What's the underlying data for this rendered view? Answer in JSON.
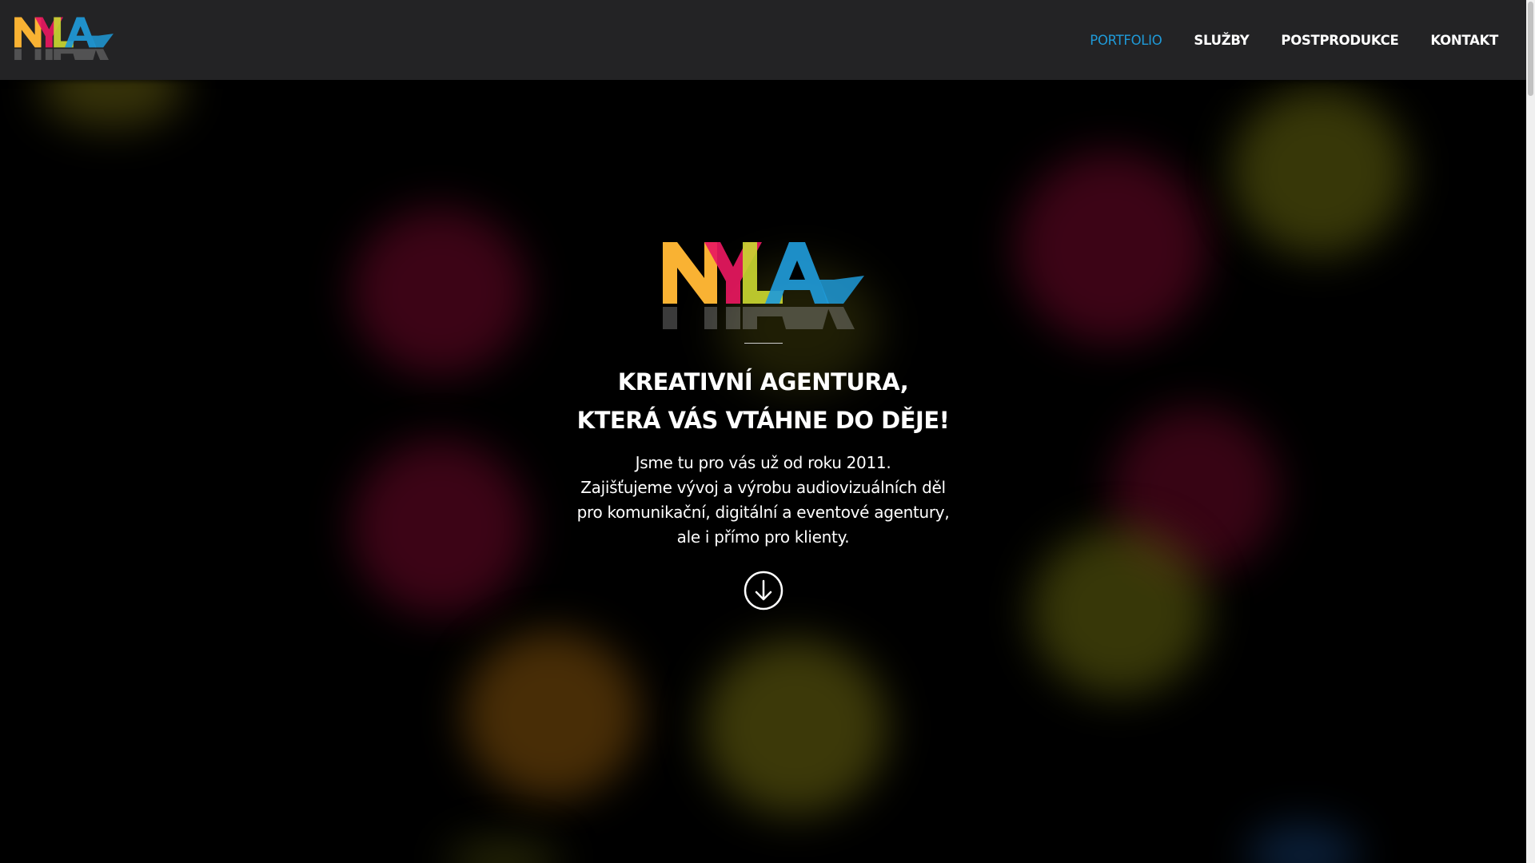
{
  "brand": {
    "name": "NYLA",
    "logo_colors": [
      "#f9b233",
      "#e8185f",
      "#c9d631",
      "#1f9ad8"
    ]
  },
  "nav": {
    "items": [
      {
        "label": "PORTFOLIO",
        "active": true
      },
      {
        "label": "SLUŽBY",
        "active": false
      },
      {
        "label": "POSTPRODUKCE",
        "active": false
      },
      {
        "label": "KONTAKT",
        "active": false
      }
    ],
    "active_color": "#1f9ad8"
  },
  "hero": {
    "title_line1": "KREATIVNÍ AGENTURA,",
    "title_line2": "KTERÁ VÁS VTÁHNE DO DĚJE!",
    "text_line1": "Jsme tu pro vás už od roku 2011.",
    "text_line2": "Zajišťujeme vývoj a výrobu audiovizuálních děl",
    "text_line3": "pro komunikační, digitální a eventové agentury,",
    "text_line4": "ale i přímo pro klienty.",
    "scroll_icon": "arrow-down-circle-icon"
  },
  "theme": {
    "background": "#000000",
    "header_background": "#232325"
  }
}
